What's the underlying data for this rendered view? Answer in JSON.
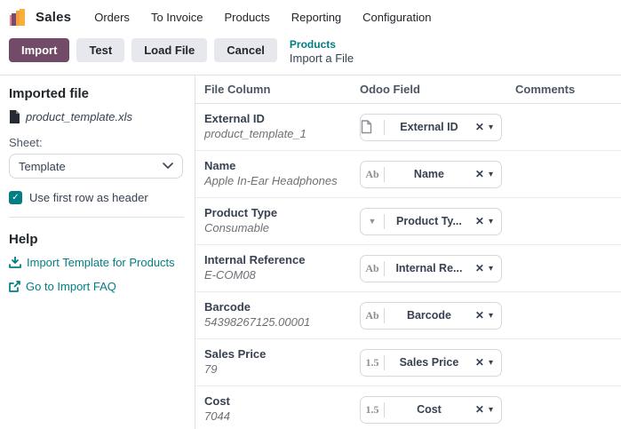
{
  "nav": {
    "app_name": "Sales",
    "items": [
      "Orders",
      "To Invoice",
      "Products",
      "Reporting",
      "Configuration"
    ]
  },
  "control_panel": {
    "import_label": "Import",
    "test_label": "Test",
    "load_file_label": "Load File",
    "cancel_label": "Cancel",
    "breadcrumb_parent": "Products",
    "breadcrumb_current": "Import a File"
  },
  "sidebar": {
    "imported_file_heading": "Imported file",
    "file_name": "product_template.xls",
    "sheet_label": "Sheet:",
    "sheet_selected": "Template",
    "first_row_label": "Use first row as header",
    "first_row_checked": true,
    "help_heading": "Help",
    "links": [
      {
        "icon": "download-icon",
        "label": "Import Template for Products"
      },
      {
        "icon": "external-link-icon",
        "label": "Go to Import FAQ"
      }
    ]
  },
  "table": {
    "headers": {
      "file_column": "File Column",
      "odoo_field": "Odoo Field",
      "comments": "Comments"
    },
    "rows": [
      {
        "column": "External ID",
        "sample": "product_template_1",
        "type_icon": "file-icon",
        "type_glyph": "",
        "field_label": "External ID",
        "comment": ""
      },
      {
        "column": "Name",
        "sample": "Apple In-Ear Headphones",
        "type_icon": "text-icon",
        "type_glyph": "Ab",
        "field_label": "Name",
        "comment": ""
      },
      {
        "column": "Product Type",
        "sample": "Consumable",
        "type_icon": "selection-icon",
        "type_glyph": "▼",
        "field_label": "Product Ty...",
        "comment": ""
      },
      {
        "column": "Internal Reference",
        "sample": "E-COM08",
        "type_icon": "text-icon",
        "type_glyph": "Ab",
        "field_label": "Internal Re...",
        "comment": ""
      },
      {
        "column": "Barcode",
        "sample": "54398267125.00001",
        "type_icon": "text-icon",
        "type_glyph": "Ab",
        "field_label": "Barcode",
        "comment": ""
      },
      {
        "column": "Sales Price",
        "sample": "79",
        "type_icon": "number-icon",
        "type_glyph": "1.5",
        "field_label": "Sales Price",
        "comment": ""
      },
      {
        "column": "Cost",
        "sample": "7044",
        "type_icon": "number-icon",
        "type_glyph": "1.5",
        "field_label": "Cost",
        "comment": ""
      }
    ]
  },
  "icons": {
    "clear": "✕",
    "caret": "▾",
    "select_chevron": "⌄",
    "checkbox_check": "✓"
  },
  "colors": {
    "primary": "#714B67",
    "link_teal": "#017E84",
    "text_dark": "#374151",
    "border": "#DEE2E6"
  }
}
